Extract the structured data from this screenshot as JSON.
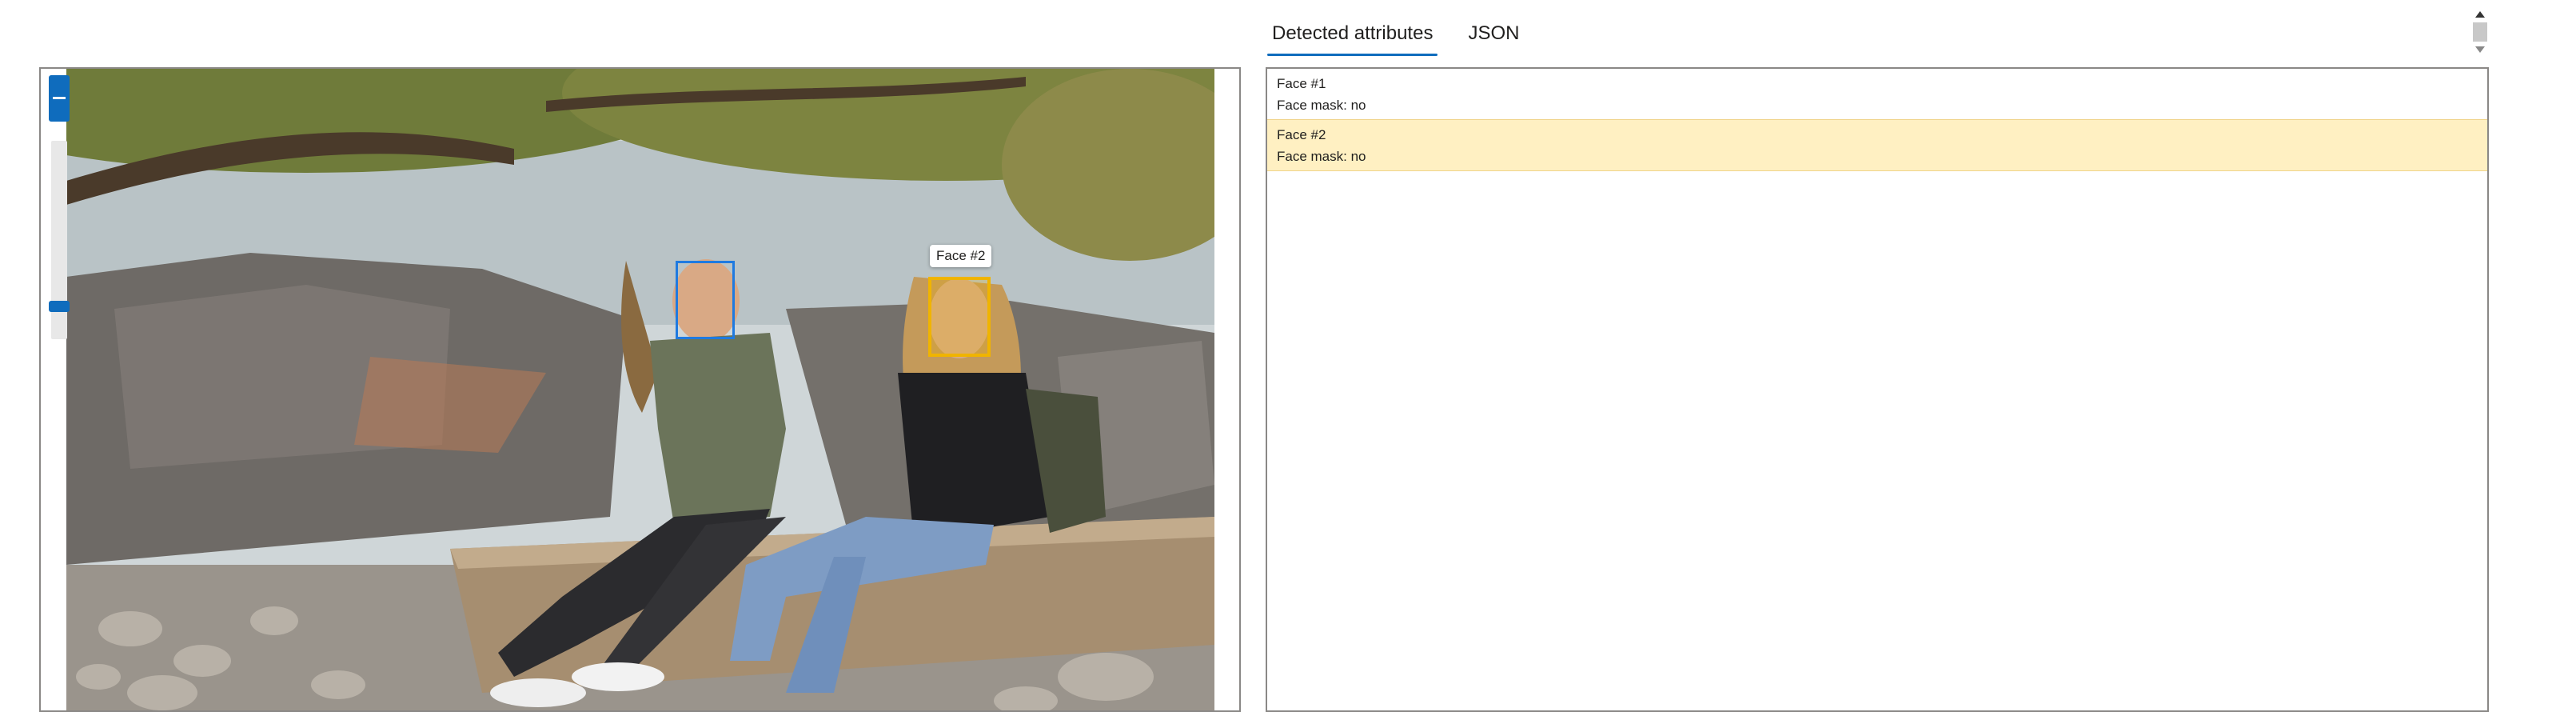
{
  "tabs": [
    {
      "label": "Detected attributes",
      "active": true
    },
    {
      "label": "JSON",
      "active": false
    }
  ],
  "image_panel": {
    "tooltip": "Face #2",
    "boxes": [
      {
        "name": "Face #1",
        "color": "#1f7ae0"
      },
      {
        "name": "Face #2",
        "color": "#f0b400"
      }
    ]
  },
  "results": {
    "faces": [
      {
        "title": "Face #1",
        "mask": "Face mask: no",
        "selected": false
      },
      {
        "title": "Face #2",
        "mask": "Face mask: no",
        "selected": true
      }
    ]
  },
  "colors": {
    "accent": "#0f6cbd",
    "selection": "#fff0c2",
    "face1_box": "#1f7ae0",
    "face2_box": "#f0b400"
  },
  "icons": [
    "zoom-out-icon",
    "scroll-up-arrow-icon",
    "scroll-down-arrow-icon"
  ]
}
